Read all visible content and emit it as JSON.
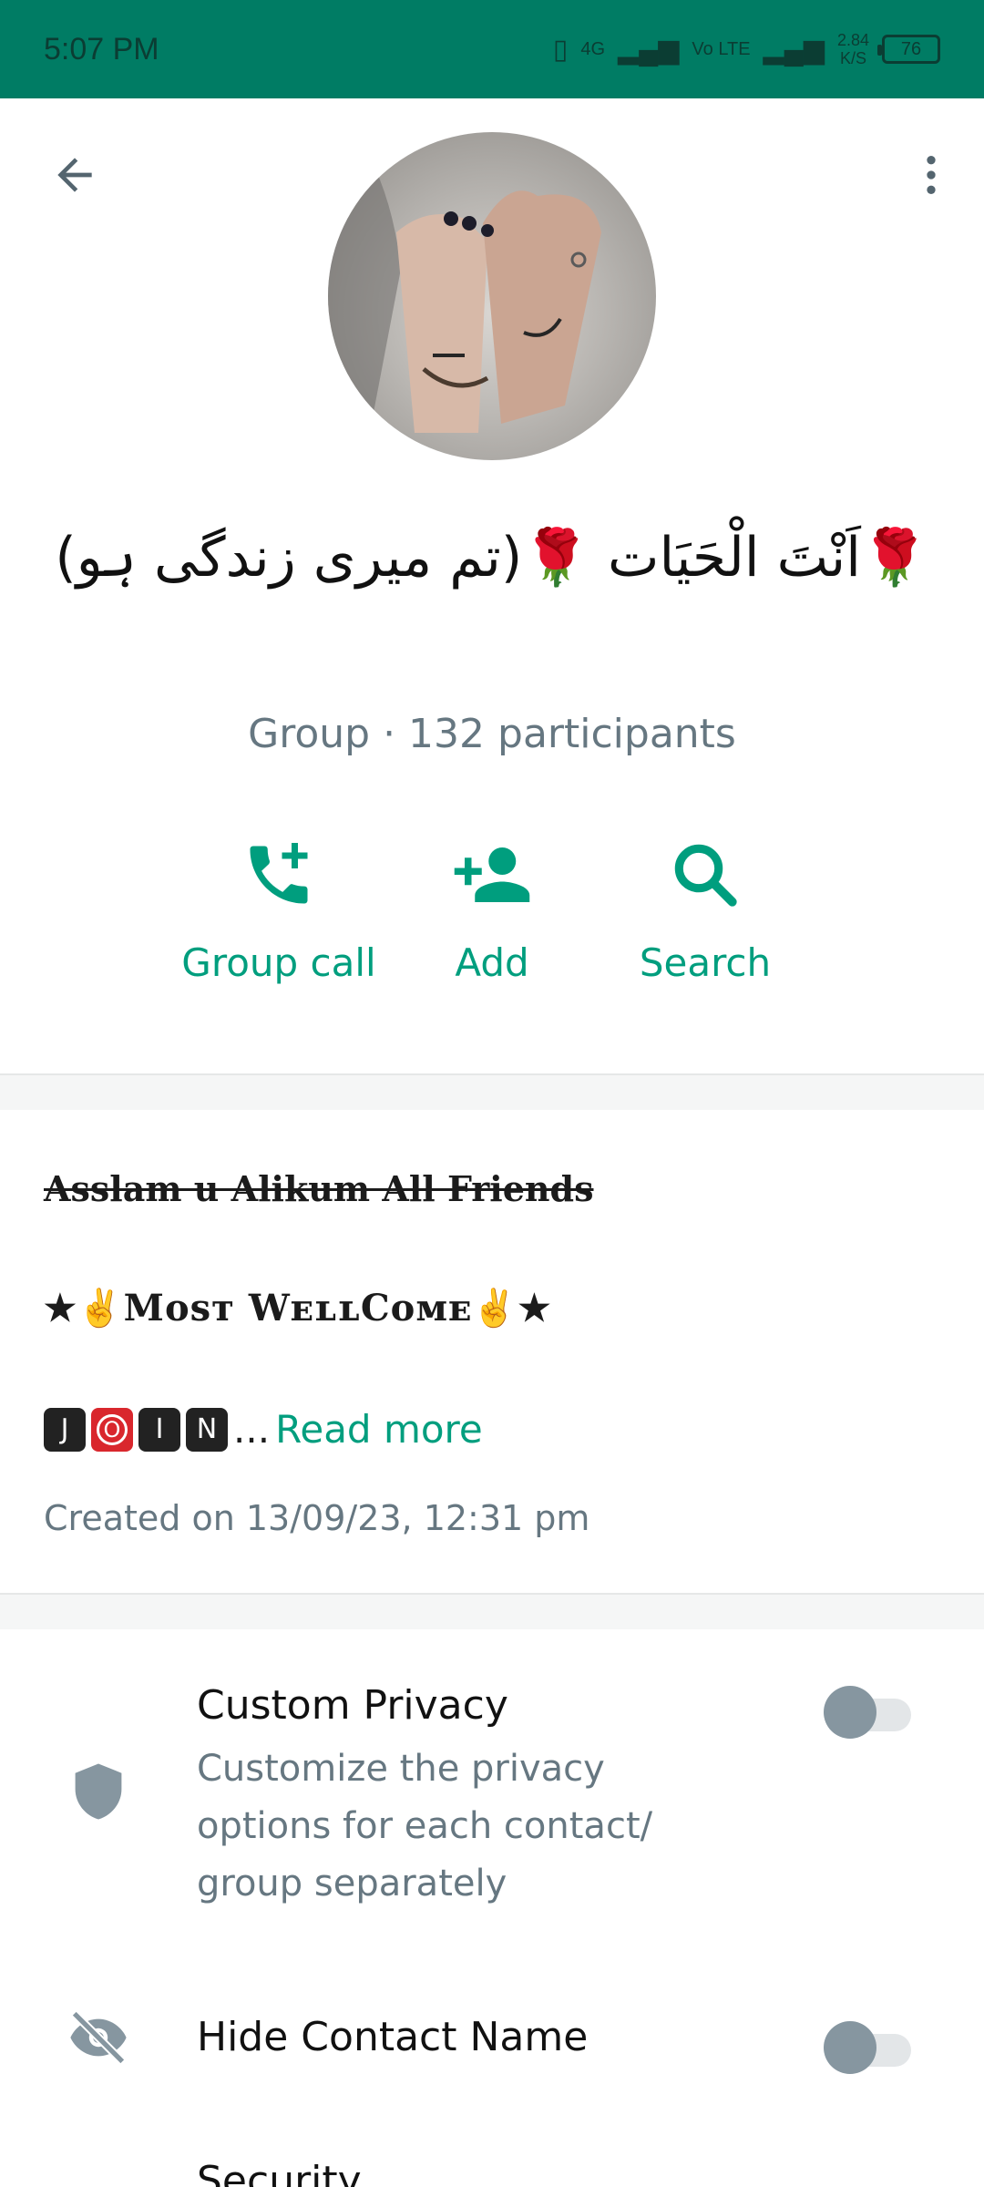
{
  "status_bar": {
    "time": "5:07 PM",
    "network": "4G",
    "volte": "Vo LTE",
    "net_speed_value": "2.84",
    "net_speed_unit": "K/S",
    "battery": "76"
  },
  "header": {
    "back_icon": "arrow-back-icon",
    "more_icon": "more-vert-icon"
  },
  "group": {
    "name": "🌹اَنْتَ الْحَیَات 🌹(تم میری زندگی ہو)",
    "meta": "Group · 132 participants"
  },
  "actions": [
    {
      "label": "Group call",
      "icon": "add-call-icon"
    },
    {
      "label": "Add",
      "icon": "person-add-icon"
    },
    {
      "label": "Search",
      "icon": "search-icon"
    }
  ],
  "description": {
    "line1": "Asslam u Alikum All Friends",
    "line2": "★✌Mᴏsᴛ WᴇʟʟCᴏᴍᴇ✌★",
    "join_letters": [
      "J",
      "O",
      "I",
      "N"
    ],
    "ellipsis": "...",
    "read_more": "Read more",
    "created": "Created on 13/09/23, 12:31 pm"
  },
  "settings": {
    "custom_privacy": {
      "title": "Custom Privacy",
      "subtitle": "Customize the privacy options for each contact/ group separately",
      "enabled": false
    },
    "hide_contact_name": {
      "title": "Hide Contact Name",
      "enabled": false
    },
    "security": {
      "title": "Security"
    }
  },
  "colors": {
    "status_bar": "#007c64",
    "accent": "#009e7e",
    "secondary_text": "#667781",
    "toggle_off": "#8696a0"
  }
}
